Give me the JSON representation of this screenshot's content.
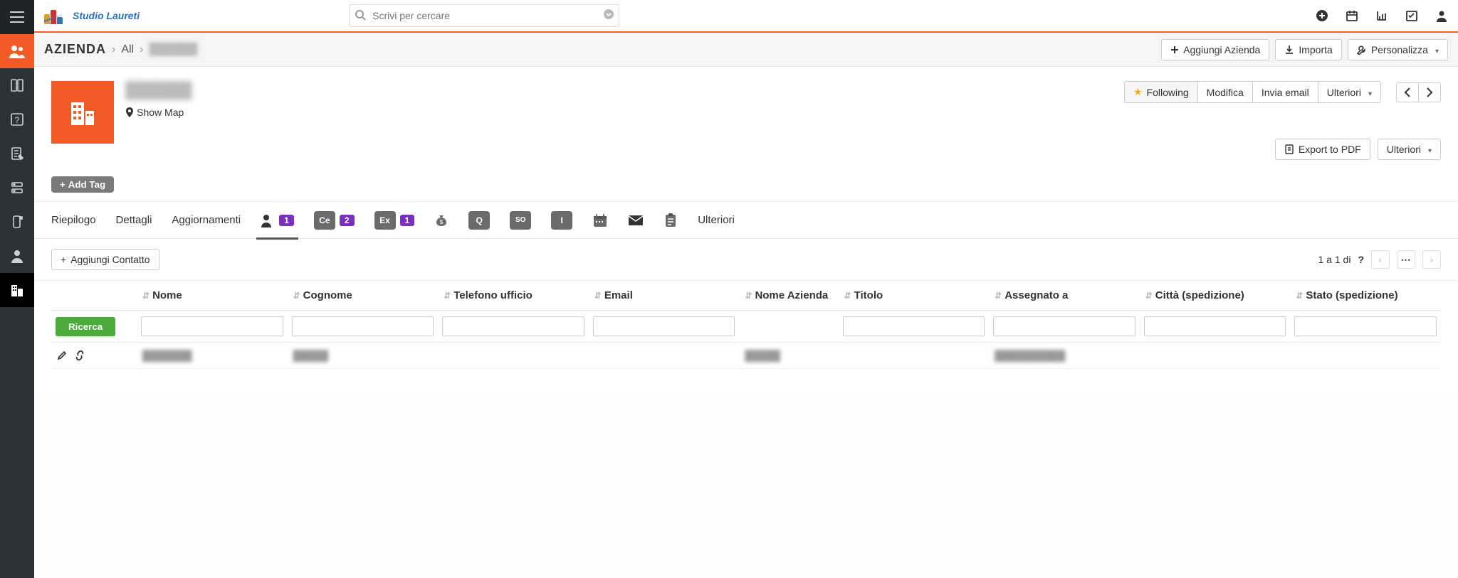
{
  "brand": "Studio Laureti",
  "search": {
    "placeholder": "Scrivi per cercare"
  },
  "breadcrumb": {
    "module": "AZIENDA",
    "all": "All"
  },
  "actions": {
    "add_company": "Aggiungi Azienda",
    "import": "Importa",
    "customize": "Personalizza"
  },
  "record": {
    "show_map": "Show Map",
    "add_tag": "Add Tag",
    "following": "Following",
    "edit": "Modifica",
    "send_email": "Invia email",
    "more": "Ulteriori",
    "export_pdf": "Export to PDF",
    "more2": "Ulteriori"
  },
  "tabs": {
    "summary": "Riepilogo",
    "details": "Dettagli",
    "updates": "Aggiornamenti",
    "contacts_count": "1",
    "ce_count": "2",
    "ex_count": "1",
    "more": "Ulteriori",
    "ce_label": "Ce",
    "ex_label": "Ex"
  },
  "subtoolbar": {
    "add_contact": "Aggiungi Contatto",
    "pager_text": "1 a 1  di ",
    "pager_q": "?"
  },
  "columns": {
    "actions": "",
    "nome": "Nome",
    "cognome": "Cognome",
    "telefono": "Telefono ufficio",
    "email": "Email",
    "azienda": "Nome Azienda",
    "titolo": "Titolo",
    "assegnato": "Assegnato a",
    "citta": "Città (spedizione)",
    "stato": "Stato (spedizione)"
  },
  "search_btn": "Ricerca"
}
